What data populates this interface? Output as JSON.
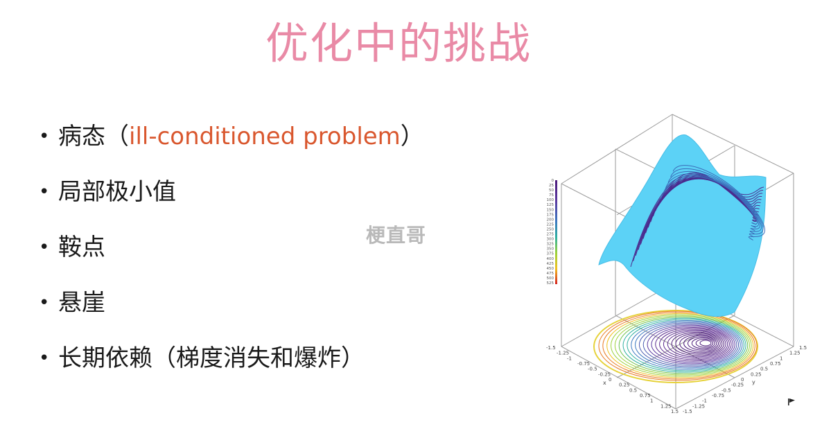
{
  "slide": {
    "title": "优化中的挑战",
    "watermark": "梗直哥",
    "bullets": [
      {
        "pre": "病态（",
        "highlight": "ill-conditioned problem",
        "post": "）"
      },
      {
        "pre": "局部极小值",
        "highlight": "",
        "post": ""
      },
      {
        "pre": "鞍点",
        "highlight": "",
        "post": ""
      },
      {
        "pre": "悬崖",
        "highlight": "",
        "post": ""
      },
      {
        "pre": "长期依赖（梯度消失和爆炸）",
        "highlight": "",
        "post": ""
      }
    ],
    "colors": {
      "title": "#e98aa6",
      "highlight": "#d9572e",
      "surface": "#5cd2f6"
    }
  },
  "chart_data": {
    "type": "surface-3d",
    "colorbar_ticks": [
      "0",
      "25",
      "50",
      "75",
      "100",
      "125",
      "150",
      "175",
      "200",
      "225",
      "250",
      "275",
      "300",
      "325",
      "350",
      "375",
      "400",
      "425",
      "450",
      "475",
      "500",
      "525"
    ],
    "x_ticks": [
      "-1.5",
      "-1.25",
      "-1",
      "-0.75",
      "-0.5",
      "-0.25",
      "0",
      "0.25",
      "0.5",
      "0.75",
      "1",
      "1.25",
      "1.5"
    ],
    "y_ticks": [
      "-1.5",
      "-1.25",
      "-1",
      "-0.75",
      "-0.5",
      "-0.25",
      "0",
      "0.25",
      "0.5",
      "0.75",
      "1",
      "1.25",
      "1.5"
    ],
    "xlabel": "x",
    "ylabel": "y"
  }
}
